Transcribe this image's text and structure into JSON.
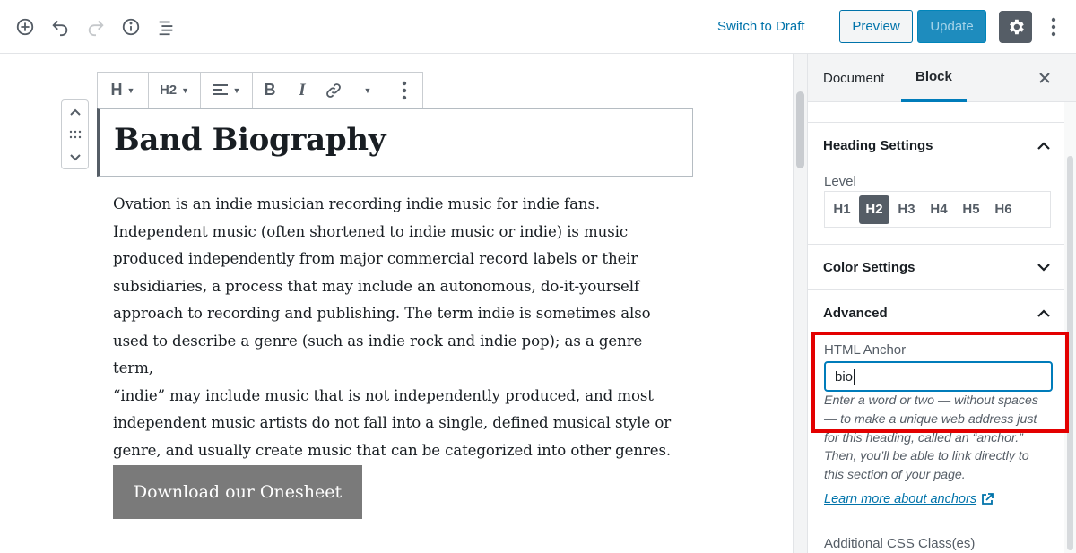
{
  "topbar": {
    "switch_draft": "Switch to Draft",
    "preview": "Preview",
    "update": "Update",
    "icons": [
      "add-block-icon",
      "undo-icon",
      "redo-icon",
      "info-icon",
      "outline-icon",
      "gear-icon",
      "more-vertical-icon"
    ]
  },
  "block_toolbar": {
    "block_type": "H",
    "heading_level": "H2",
    "bold": "B",
    "italic": "I"
  },
  "editor": {
    "heading": "Band Biography",
    "paragraph_lines": [
      "Ovation is an indie musician recording indie music for indie fans.",
      "Independent music (often shortened to indie music or indie) is music",
      "produced independently from major commercial record labels or their",
      "subsidiaries, a process that may include an autonomous, do-it-yourself",
      "approach to recording and publishing. The term indie is sometimes also",
      "used to describe a genre (such as indie rock and indie pop); as a genre term,",
      "“indie” may include music that is not independently produced, and most",
      "independent music artists do not fall into a single, defined musical style or",
      "genre, and usually create music that can be categorized into other genres."
    ],
    "button_label": "Download our Onesheet"
  },
  "sidebar": {
    "tab_document": "Document",
    "tab_block": "Block",
    "heading_settings": "Heading Settings",
    "level_label": "Level",
    "levels": [
      "H1",
      "H2",
      "H3",
      "H4",
      "H5",
      "H6"
    ],
    "active_level": "H2",
    "color_settings": "Color Settings",
    "advanced": "Advanced",
    "html_anchor_label": "HTML Anchor",
    "html_anchor_value": "bio",
    "help_lines": [
      "Enter a word or two — without spaces",
      "— to make a unique web address just",
      "for this heading, called an “anchor.”",
      "Then, you’ll be able to link directly to",
      "this section of your page."
    ],
    "learn_more": "Learn more about anchors",
    "additional_css": "Additional CSS Class(es)"
  },
  "colors": {
    "accent": "#0073aa",
    "highlight": "#e30000",
    "active_level_bg": "#555d66",
    "button_bg": "#7a7a7a"
  }
}
